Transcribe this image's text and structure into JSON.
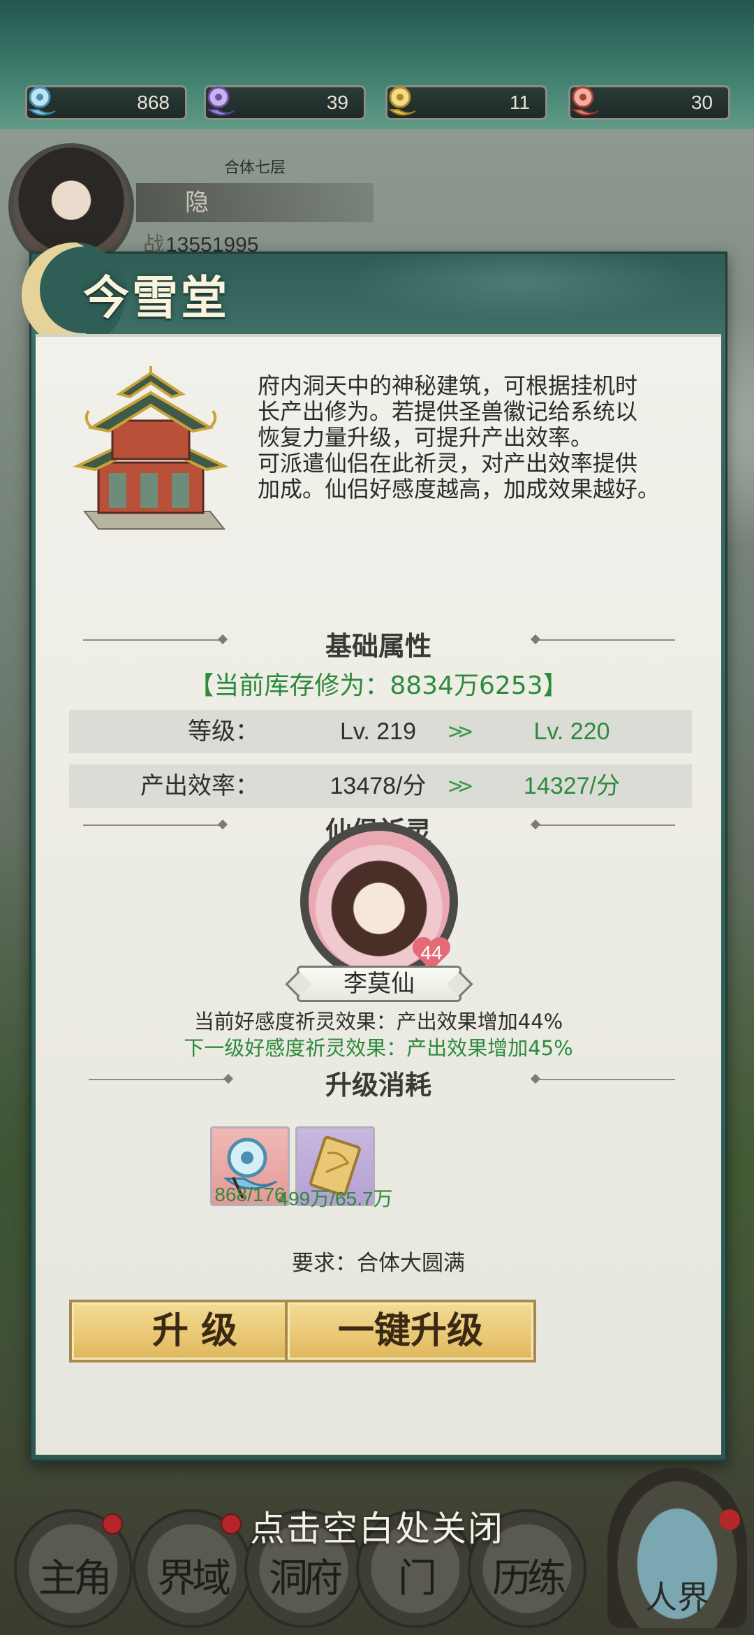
{
  "currencies": [
    {
      "icon": "blue-spirit-gem-icon",
      "value": "868"
    },
    {
      "icon": "purple-spirit-gem-icon",
      "value": "39"
    },
    {
      "icon": "gold-spirit-gem-icon",
      "value": "11"
    },
    {
      "icon": "red-spirit-gem-icon",
      "value": "30"
    }
  ],
  "player": {
    "realm": "合体七层",
    "name": "隐",
    "power_icon": "战",
    "power": "13551995"
  },
  "modal": {
    "title": "今雪堂",
    "description": [
      "府内洞天中的神秘建筑，可根据挂机时",
      "长产出修为。若提供圣兽徽记给系统以",
      "恢复力量升级，可提升产出效率。",
      "可派遣仙侣在此祈灵，对产出效率提供",
      "加成。仙侣好感度越高，加成效果越好。"
    ],
    "basic_section": "基础属性",
    "stock": "【当前库存修为：8834万6253】",
    "stats": [
      {
        "label": "等级：",
        "current": "Lv. 219",
        "arrow": ">>",
        "next": "Lv. 220"
      },
      {
        "label": "产出效率：",
        "current": "13478/分",
        "arrow": ">>",
        "next": "14327/分"
      }
    ],
    "partner_section": "仙侣祈灵",
    "partner": {
      "name": "李莫仙",
      "affection": "44"
    },
    "current_effect": "当前好感度祈灵效果：产出效果增加44%",
    "next_effect": "下一级好感度祈灵效果：产出效果增加45%",
    "cost_section": "升级消耗",
    "costs": [
      {
        "icon": "blue-spirit-gem-icon",
        "qty": "868/176"
      },
      {
        "icon": "gold-token-card-icon",
        "qty": "499万/65.7万"
      }
    ],
    "requirement": "要求：合体大圆满",
    "upgrade_label": "升 级",
    "one_key_label": "一键升级"
  },
  "close_hint": "点击空白处关闭",
  "nav": [
    {
      "label": "主角"
    },
    {
      "label": "界域"
    },
    {
      "label": "洞府"
    },
    {
      "label": "门"
    },
    {
      "label": "历练"
    }
  ],
  "portal_label": "人界",
  "colors": {
    "accent_green": "#2d8a3b",
    "button_gold": "#e9c774",
    "header_teal": "#2f5e56"
  }
}
